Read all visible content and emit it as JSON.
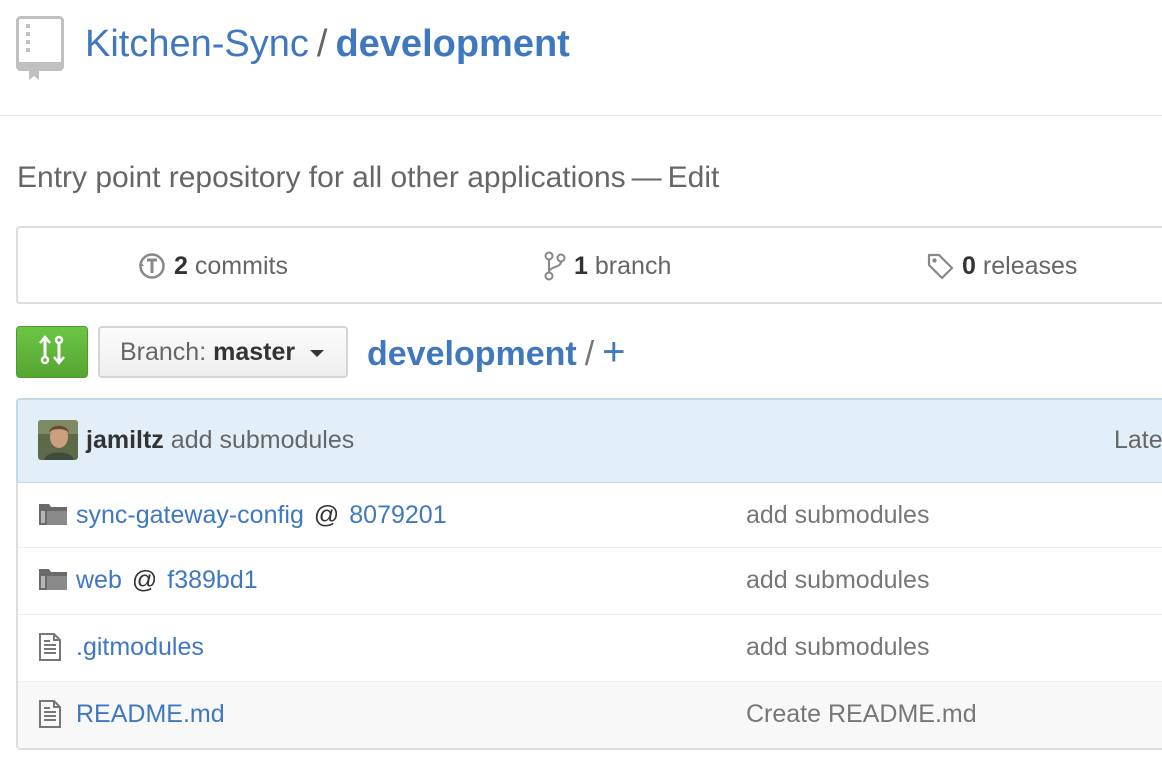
{
  "repo": {
    "owner": "Kitchen-Sync",
    "separator": "/",
    "name": "development",
    "description": "Entry point repository for all other applications",
    "dash": "—",
    "edit_label": "Edit"
  },
  "summary": {
    "commits": {
      "count": "2",
      "label": "commits"
    },
    "branches": {
      "count": "1",
      "label": "branch"
    },
    "releases": {
      "count": "0",
      "label": "releases"
    }
  },
  "toolbar": {
    "branch_prefix": "Branch:",
    "branch_name": "master",
    "breadcrumb_path": "development",
    "breadcrumb_sep": "/",
    "add_file": "+"
  },
  "latest_commit": {
    "author": "jamiltz",
    "message": "add submodules",
    "latest_label": "Late"
  },
  "files": [
    {
      "type": "submodule",
      "name": "sync-gateway-config",
      "at": "@",
      "ref": "8079201",
      "message": "add submodules"
    },
    {
      "type": "submodule",
      "name": "web",
      "at": "@",
      "ref": "f389bd1",
      "message": "add submodules"
    },
    {
      "type": "file",
      "name": ".gitmodules",
      "message": "add submodules"
    },
    {
      "type": "file",
      "name": "README.md",
      "message": "Create README.md"
    }
  ],
  "colors": {
    "link": "#4078c0",
    "compare_button": "#6cc644",
    "commit_tease_bg": "#e3eff8"
  },
  "icons": [
    "repo-icon",
    "history-icon",
    "git-branch-icon",
    "tag-icon",
    "compare-icon",
    "submodule-icon",
    "file-text-icon"
  ]
}
